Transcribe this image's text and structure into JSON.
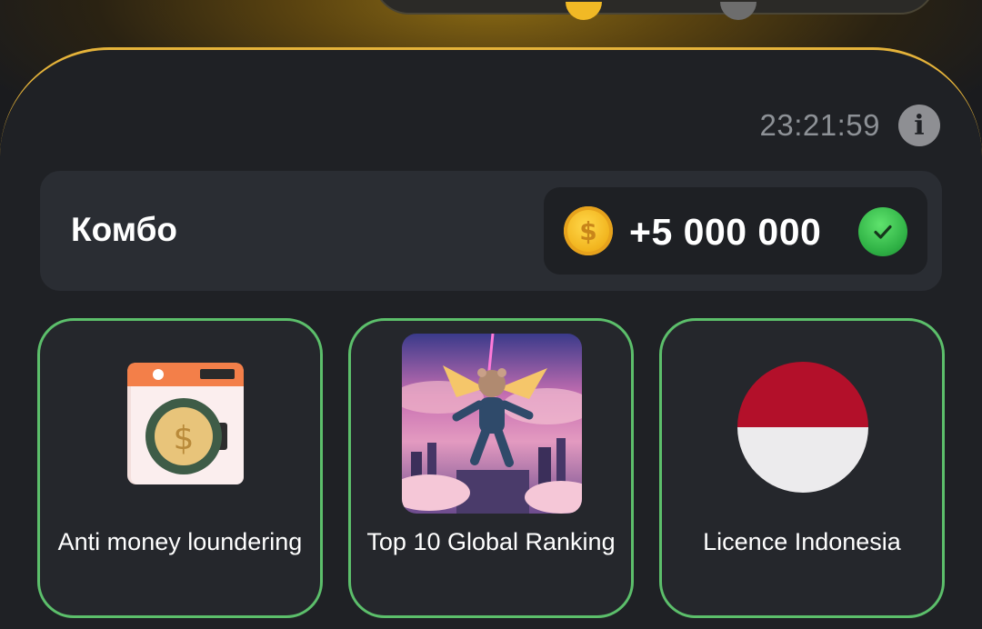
{
  "header": {
    "time": "23:21:59",
    "info_label": "i"
  },
  "combo": {
    "title": "Комбо",
    "reward": "+5 000 000",
    "coin_symbol": "$",
    "status": "check-icon"
  },
  "cards": [
    {
      "label": "Anti money loundering",
      "icon": "washing-machine-dollar-icon"
    },
    {
      "label": "Top 10 Global Ranking",
      "icon": "hamster-astronaut-image"
    },
    {
      "label": "Licence Indonesia",
      "icon": "indonesia-flag-icon"
    }
  ],
  "colors": {
    "accent_gold": "#e5b33a",
    "card_border_green": "#5cbf6b",
    "background": "#1f2125"
  }
}
